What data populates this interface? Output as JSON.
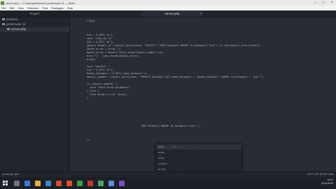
{
  "window": {
    "title": "server.php — C:\\xampp\\htdocs\\1.pertemuan 11 — Atom",
    "controls": [
      "–",
      "□",
      "×"
    ]
  },
  "menu": [
    "File",
    "Edit",
    "View",
    "Selection",
    "Find",
    "Packages",
    "Help"
  ],
  "tree": {
    "header": "Project",
    "items": [
      "pertemu",
      "pertemuan 11",
      "server.php"
    ]
  },
  "tab": {
    "label": "server.php",
    "close": "×"
  },
  "code": [
    "<?php",
    "",
    "",
    "",
    "$id = $_GET['id'];",
    "case \"view_by_id\" :",
    "$id = $_GET['id'];",
    "$query_tampil_id = mysqli_query($con, \"SELECT * FROM kategori WHERE id_kategori='$id'\") or die(mysqli_error($con));",
    "$data_array = array ();",
    "$data_array = mysqli_fetch_assoc($query_tampil_id);",
    "echo \"[\". json_encode($data_array);",
    "break;",
    "",
    "case \"update\" :",
    "$id = $_GET['id'];",
    "$nama_kategori = $_GET['nama_kategori'];",
    "$query_update = mysqli_query($con, \"UPDATE kategori SET nama_kategori = '$nama_kategori' WHERE id_kategori = '$id'\");",
    "",
    "if ($query_update) {",
    "  echo \"Data telah Diupdate\";",
    "} else {",
    "  echo mysqli_error ($con);",
    "}",
    "",
    "",
    "",
    "",
    "",
    "",
    "",
    "                                    ROM kategori WHERE id_kategori='$id'\");",
    "",
    "",
    "",
    "?>"
  ],
  "autocomplete": [
    {
      "name": "echo",
      "desc": "echo \"\";"
    },
    {
      "name": "echo",
      "desc": "- - - - - - - - - - - - -"
    },
    {
      "name": "else",
      "desc": "- - - - - - -"
    },
    {
      "name": "elseif",
      "desc": "- - - - - - -"
    },
    {
      "name": "error",
      "desc": "- - - - -"
    }
  ],
  "status": {
    "left": "server.php   18:6",
    "right": "CRLF   UTF-8   PHP   0 files"
  },
  "tray": {
    "time": "10:11",
    "date": "10/11/2019"
  }
}
